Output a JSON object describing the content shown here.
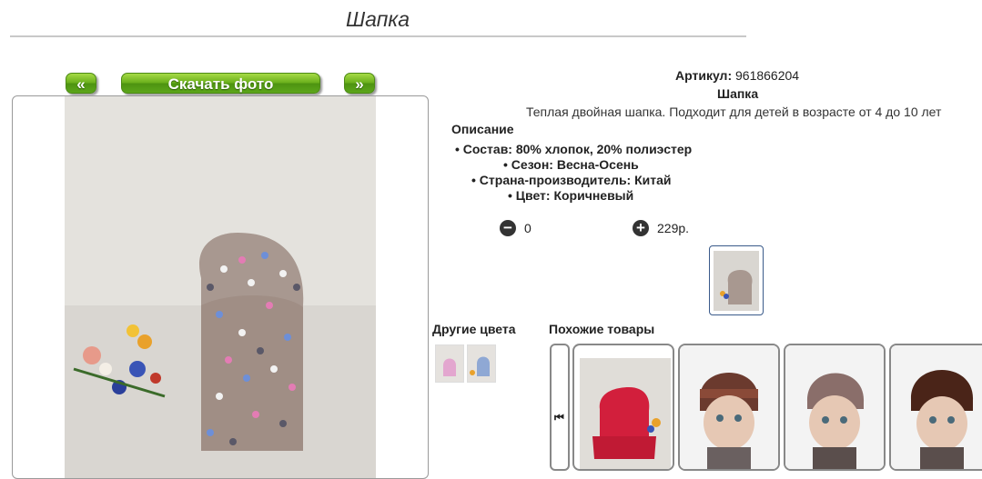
{
  "page": {
    "title": "Шапка"
  },
  "gallery": {
    "prev_label": "«",
    "download_label": "Скачать фото",
    "next_label": "»"
  },
  "product": {
    "article_label": "Артикул:",
    "article_value": "961866204",
    "name": "Шапка",
    "description": "Теплая двойная шапка. Подходит для детей в возрасте от 4 до 10 лет",
    "specs_heading": "Описание",
    "specs": [
      "Состав: 80% хлопок, 20% полиэстер",
      "Сезон: Весна-Осень",
      "Страна-производитель: Китай",
      "Цвет: Коричневый"
    ],
    "quantity": "0",
    "price": "229р."
  },
  "sections": {
    "other_colors": "Другие цвета",
    "similar": "Похожие товары"
  },
  "colors": {
    "accent_green": "#6ab01c",
    "hat": "#a89890"
  }
}
